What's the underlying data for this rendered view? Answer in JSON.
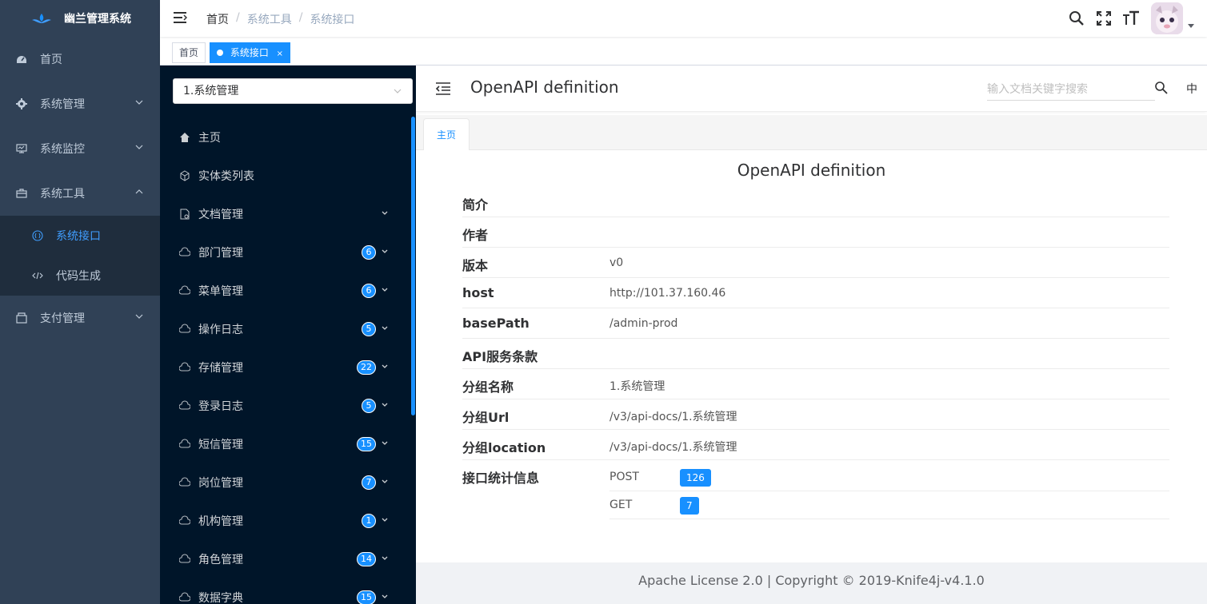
{
  "app": {
    "name": "幽兰管理系统"
  },
  "sidebar": {
    "items": [
      {
        "label": "首页"
      },
      {
        "label": "系统管理"
      },
      {
        "label": "系统监控"
      },
      {
        "label": "系统工具"
      },
      {
        "label": "支付管理"
      }
    ],
    "sub_items": [
      {
        "label": "系统接口"
      },
      {
        "label": "代码生成"
      }
    ]
  },
  "navbar": {
    "breadcrumb": [
      "首页",
      "系统工具",
      "系统接口"
    ],
    "separator": "/"
  },
  "tags": [
    {
      "label": "首页"
    },
    {
      "label": "系统接口",
      "close": "×"
    }
  ],
  "doc_menu": {
    "group_selected": "1.系统管理",
    "items": [
      {
        "label": "主页",
        "icon": "home-icon"
      },
      {
        "label": "实体类列表",
        "icon": "entity-icon"
      },
      {
        "label": "文档管理",
        "icon": "doc-icon"
      },
      {
        "label": "部门管理",
        "count": "6"
      },
      {
        "label": "菜单管理",
        "count": "6"
      },
      {
        "label": "操作日志",
        "count": "5"
      },
      {
        "label": "存储管理",
        "count": "22"
      },
      {
        "label": "登录日志",
        "count": "5"
      },
      {
        "label": "短信管理",
        "count": "15"
      },
      {
        "label": "岗位管理",
        "count": "7"
      },
      {
        "label": "机构管理",
        "count": "1"
      },
      {
        "label": "角色管理",
        "count": "14"
      },
      {
        "label": "数据字典",
        "count": "15"
      }
    ]
  },
  "content": {
    "title": "OpenAPI definition",
    "search_placeholder": "输入文档关键字搜索",
    "lang": "中",
    "tab": "主页",
    "doc_title": "OpenAPI definition",
    "info": [
      {
        "key": "简介",
        "value": ""
      },
      {
        "key": "作者",
        "value": ""
      },
      {
        "key": "版本",
        "value": "v0"
      },
      {
        "key": "host",
        "value": "http://101.37.160.46"
      },
      {
        "key": "basePath",
        "value": "/admin-prod"
      },
      {
        "key": "API服务条款",
        "value": ""
      },
      {
        "key": "分组名称",
        "value": "1.系统管理"
      },
      {
        "key": "分组Url",
        "value": "/v3/api-docs/1.系统管理"
      },
      {
        "key": "分组location",
        "value": "/v3/api-docs/1.系统管理"
      }
    ],
    "stats_label": "接口统计信息",
    "stats": [
      {
        "method": "POST",
        "count": "126"
      },
      {
        "method": "GET",
        "count": "7"
      }
    ],
    "footer": "Apache License 2.0 | Copyright © 2019-Knife4j-v4.1.0"
  },
  "colors": {
    "sidebar_bg": "#304156",
    "doc_menu_bg": "#001529",
    "accent": "#1890ff",
    "active_link": "#409eff"
  }
}
